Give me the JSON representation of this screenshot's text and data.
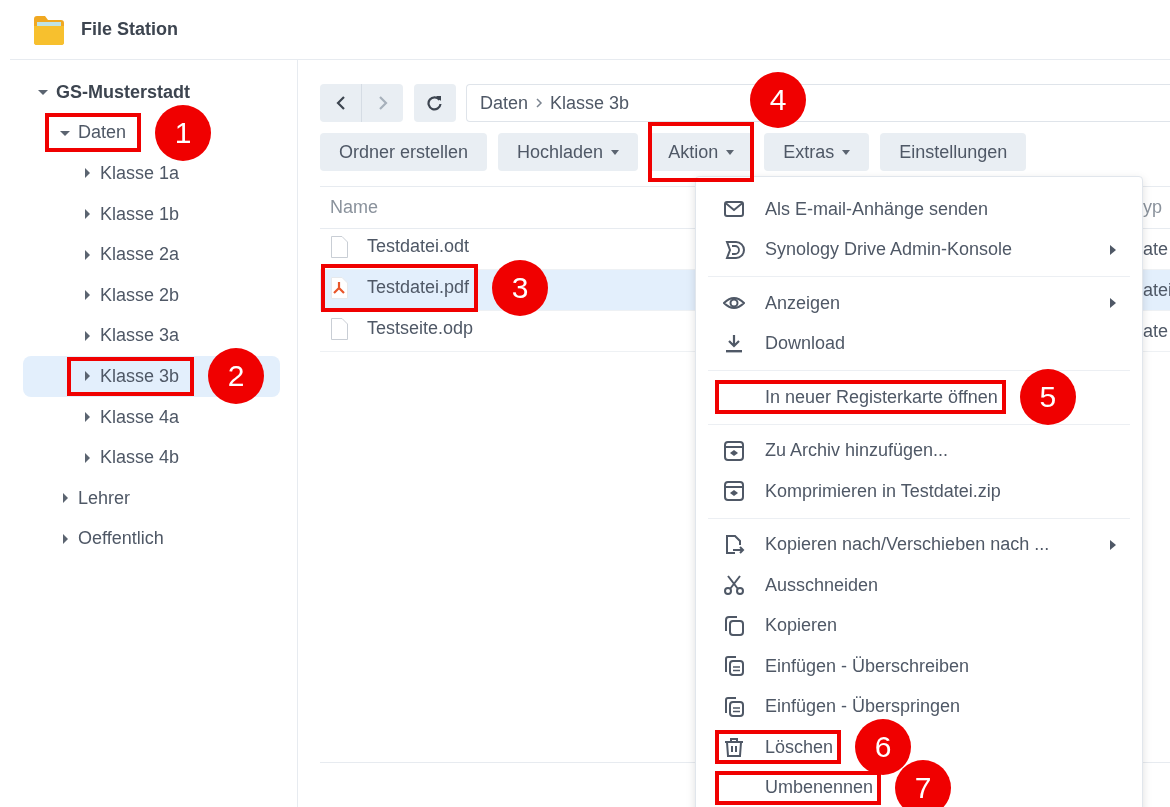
{
  "window": {
    "title": "File Station"
  },
  "sidebar": {
    "tree": [
      {
        "label": "GS-Musterstadt",
        "expanded": true,
        "selected": false,
        "children": [
          {
            "label": "Daten",
            "expanded": true,
            "selected": false,
            "annotation": "1",
            "children": [
              {
                "label": "Klasse 1a",
                "expanded": false,
                "selected": false
              },
              {
                "label": "Klasse 1b",
                "expanded": false,
                "selected": false
              },
              {
                "label": "Klasse 2a",
                "expanded": false,
                "selected": false
              },
              {
                "label": "Klasse 2b",
                "expanded": false,
                "selected": false
              },
              {
                "label": "Klasse 3a",
                "expanded": false,
                "selected": false
              },
              {
                "label": "Klasse 3b",
                "expanded": false,
                "selected": true,
                "annotation": "2"
              },
              {
                "label": "Klasse 4a",
                "expanded": false,
                "selected": false
              },
              {
                "label": "Klasse 4b",
                "expanded": false,
                "selected": false
              }
            ]
          },
          {
            "label": "Lehrer",
            "expanded": false,
            "selected": false
          },
          {
            "label": "Oeffentlich",
            "expanded": false,
            "selected": false
          }
        ]
      }
    ]
  },
  "nav_buttons": [
    {
      "kind": "back",
      "disabled": false
    },
    {
      "kind": "forward",
      "disabled": true
    },
    {
      "kind": "refresh",
      "disabled": false
    }
  ],
  "path": {
    "segments": [
      "Daten",
      "Klasse 3b"
    ]
  },
  "toolbar": [
    {
      "label": "Ordner erstellen",
      "dropdown": false
    },
    {
      "label": "Hochladen",
      "dropdown": true
    },
    {
      "label": "Aktion",
      "dropdown": true,
      "annotation": "4"
    },
    {
      "label": "Extras",
      "dropdown": true
    },
    {
      "label": "Einstellungen",
      "dropdown": false
    }
  ],
  "file_list": {
    "columns": [
      "Name",
      "yp"
    ],
    "rows": [
      {
        "name": "Testdatei.odt",
        "kind": "document",
        "selected": false,
        "column_2": "ate"
      },
      {
        "name": "Testdatei.pdf",
        "kind": "pdf",
        "selected": true,
        "column_2": "atei",
        "annotation": "3"
      },
      {
        "name": "Testseite.odp",
        "kind": "document",
        "selected": false,
        "column_2": "ate"
      }
    ]
  },
  "menu": {
    "groups": [
      [
        {
          "label": "Als E-mail-Anhänge senden",
          "submenu": false
        },
        {
          "label": "Synology Drive Admin-Konsole",
          "submenu": true
        }
      ],
      [
        {
          "label": "Anzeigen",
          "submenu": true
        },
        {
          "label": "Download",
          "submenu": false
        }
      ],
      [
        {
          "label": "In neuer Registerkarte öffnen",
          "submenu": false,
          "annotation": "5"
        }
      ],
      [
        {
          "label": "Zu Archiv hinzufügen...",
          "submenu": false
        },
        {
          "label": "Komprimieren in Testdatei.zip",
          "submenu": false
        }
      ],
      [
        {
          "label": "Kopieren nach/Verschieben nach ...",
          "submenu": true
        },
        {
          "label": "Ausschneiden",
          "submenu": false
        },
        {
          "label": "Kopieren",
          "submenu": false
        },
        {
          "label": "Einfügen - Überschreiben",
          "submenu": false
        },
        {
          "label": "Einfügen - Überspringen",
          "submenu": false
        },
        {
          "label": "Löschen",
          "submenu": false,
          "annotation": "6"
        },
        {
          "label": "Umbenennen",
          "submenu": false,
          "annotation": "7"
        }
      ]
    ]
  }
}
